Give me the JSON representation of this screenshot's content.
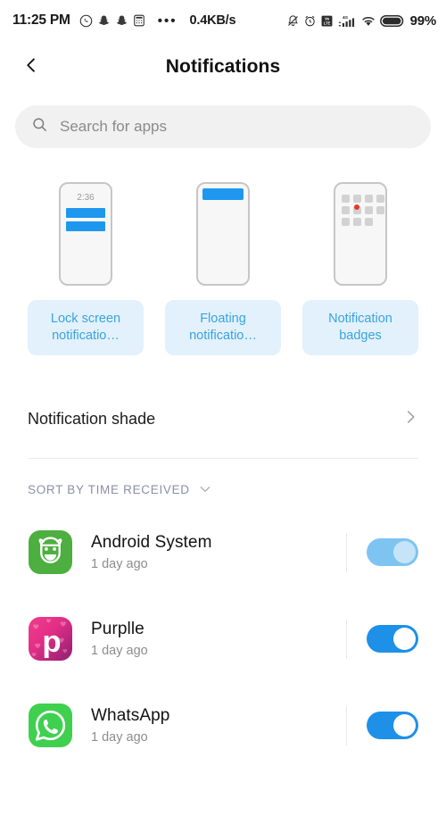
{
  "statusbar": {
    "time": "11:25 PM",
    "icons_left": [
      "whatsapp-icon",
      "snapchat-icon",
      "snapchat-icon",
      "calculator-icon"
    ],
    "overflow": "•••",
    "network_speed": "0.4KB/s",
    "icons_right": [
      "bell-muted-icon",
      "alarm-icon",
      "volte-icon",
      "signal-4g-icon",
      "wifi-icon",
      "battery-icon"
    ],
    "battery_percent": "99%"
  },
  "header": {
    "title": "Notifications",
    "back_icon": "chevron-left-icon"
  },
  "search": {
    "placeholder": "Search for apps",
    "value": "",
    "icon": "search-icon"
  },
  "cards": [
    {
      "label": "Lock screen notificatio…",
      "preview": "lock-screen",
      "preview_time": "2:36"
    },
    {
      "label": "Floating notificatio…",
      "preview": "floating"
    },
    {
      "label": "Notification badges",
      "preview": "badges"
    }
  ],
  "shade": {
    "label": "Notification shade",
    "chevron": "chevron-right-icon"
  },
  "sort": {
    "label": "SORT BY TIME RECEIVED",
    "caret": "chevron-down-icon"
  },
  "apps": [
    {
      "name": "Android System",
      "time": "1 day ago",
      "icon": "android-system-icon",
      "toggle_state": "on-disabled"
    },
    {
      "name": "Purplle",
      "time": "1 day ago",
      "icon": "purplle-icon",
      "toggle_state": "on"
    },
    {
      "name": "WhatsApp",
      "time": "1 day ago",
      "icon": "whatsapp-icon",
      "toggle_state": "on"
    }
  ],
  "colors": {
    "accent_blue": "#1e90e8",
    "chip_bg": "#e2f1fb",
    "chip_text": "#3aa3e3",
    "toggle_dim": "#7ec4f0",
    "sort_text": "#8c8fa8",
    "badge_red": "#e8392a"
  }
}
